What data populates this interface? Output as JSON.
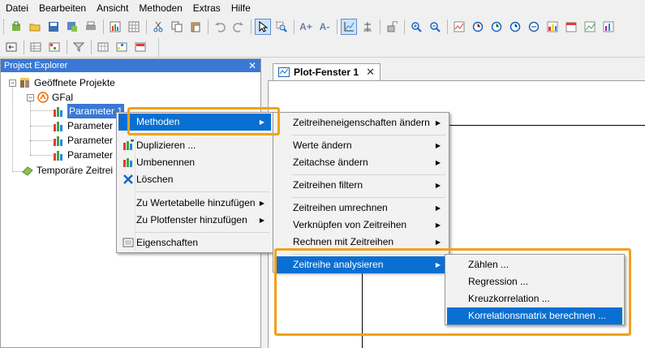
{
  "menubar": {
    "items": [
      "Datei",
      "Bearbeiten",
      "Ansicht",
      "Methoden",
      "Extras",
      "Hilfe"
    ]
  },
  "toolbar": {
    "font_increase": "A+",
    "font_decrease": "A-"
  },
  "explorer": {
    "title": "Project Explorer",
    "close": "✕",
    "root": "Geöffnete Projekte",
    "project": "GFal",
    "params": [
      "Parameter 1",
      "Parameter",
      "Parameter",
      "Parameter"
    ],
    "temp": "Temporäre Zeitrei"
  },
  "plot": {
    "tab_label": "Plot-Fenster 1",
    "tab_close": "✕"
  },
  "context_menu": {
    "items": [
      "Methoden",
      "Duplizieren ...",
      "Umbenennen",
      "Löschen",
      "Zu Wertetabelle hinzufügen",
      "Zu Plotfenster hinzufügen",
      "Eigenschaften"
    ]
  },
  "methoden_menu": {
    "items": [
      "Zeitreiheneigenschaften ändern",
      "Werte ändern",
      "Zeitachse ändern",
      "Zeitreihen filtern",
      "Zeitreihen umrechnen",
      "Verknüpfen von Zeitreihen",
      "Rechnen mit Zeitreihen",
      "Zeitreihe analysieren"
    ]
  },
  "analysieren_menu": {
    "items": [
      "Zählen ...",
      "Regression ...",
      "Kreuzkorrelation ...",
      "Korrelationsmatrix berechnen ..."
    ]
  },
  "colors": {
    "highlight": "#0a6fd2",
    "callout": "#f0a21a",
    "title_bar": "#3a78d4"
  }
}
